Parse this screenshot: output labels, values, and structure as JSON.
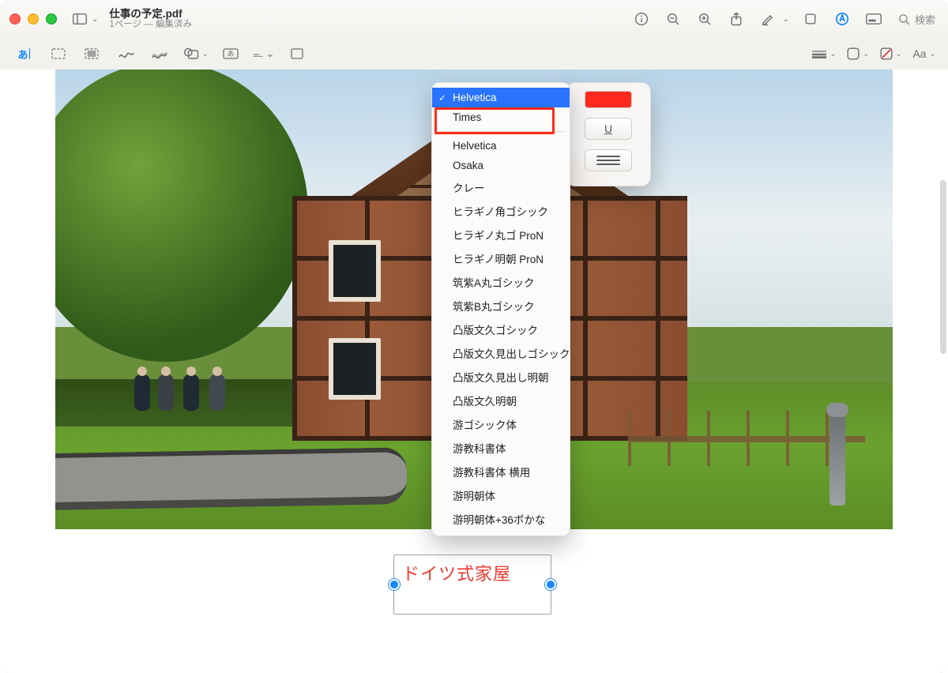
{
  "window": {
    "title": "仕事の予定.pdf",
    "subtitle": "1ページ — 編集済み"
  },
  "search": {
    "placeholder": "検索"
  },
  "markup": {
    "font_button_label": "Aa"
  },
  "font_popover": {
    "color": "#ff2a1f",
    "underline_label": "U"
  },
  "font_menu": {
    "selected": "Helvetica",
    "highlighted": "Times",
    "section1": [
      "Helvetica",
      "Times"
    ],
    "section2": [
      "Helvetica",
      "Osaka",
      "クレー",
      "ヒラギノ角ゴシック",
      "ヒラギノ丸ゴ ProN",
      "ヒラギノ明朝 ProN",
      "筑紫A丸ゴシック",
      "筑紫B丸ゴシック",
      "凸版文久ゴシック",
      "凸版文久見出しゴシック",
      "凸版文久見出し明朝",
      "凸版文久明朝",
      "游ゴシック体",
      "游教科書体",
      "游教科書体 横用",
      "游明朝体",
      "游明朝体+36ポかな"
    ]
  },
  "annotation": {
    "textbox_label": "ドイツ式家屋"
  }
}
